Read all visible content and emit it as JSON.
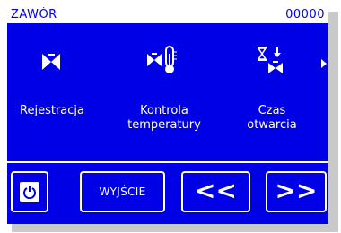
{
  "header": {
    "title": "ZAWÓR",
    "counter": "00000"
  },
  "menu": {
    "items": [
      {
        "label_line1": "Rejestracja",
        "label_line2": "",
        "icon": "valve-icon"
      },
      {
        "label_line1": "Kontrola",
        "label_line2": "temperatury",
        "icon": "valve-thermometer-icon"
      },
      {
        "label_line1": "Czas",
        "label_line2": "otwarcia",
        "icon": "hourglass-valve-icon"
      }
    ],
    "more_indicator": "arrow-right-icon"
  },
  "buttons": {
    "power_icon": "power-icon",
    "exit_label": "WYJŚCIE",
    "prev_label": "<<",
    "next_label": ">>"
  },
  "colors": {
    "background": "#0000e6",
    "foreground": "#ffffff"
  }
}
